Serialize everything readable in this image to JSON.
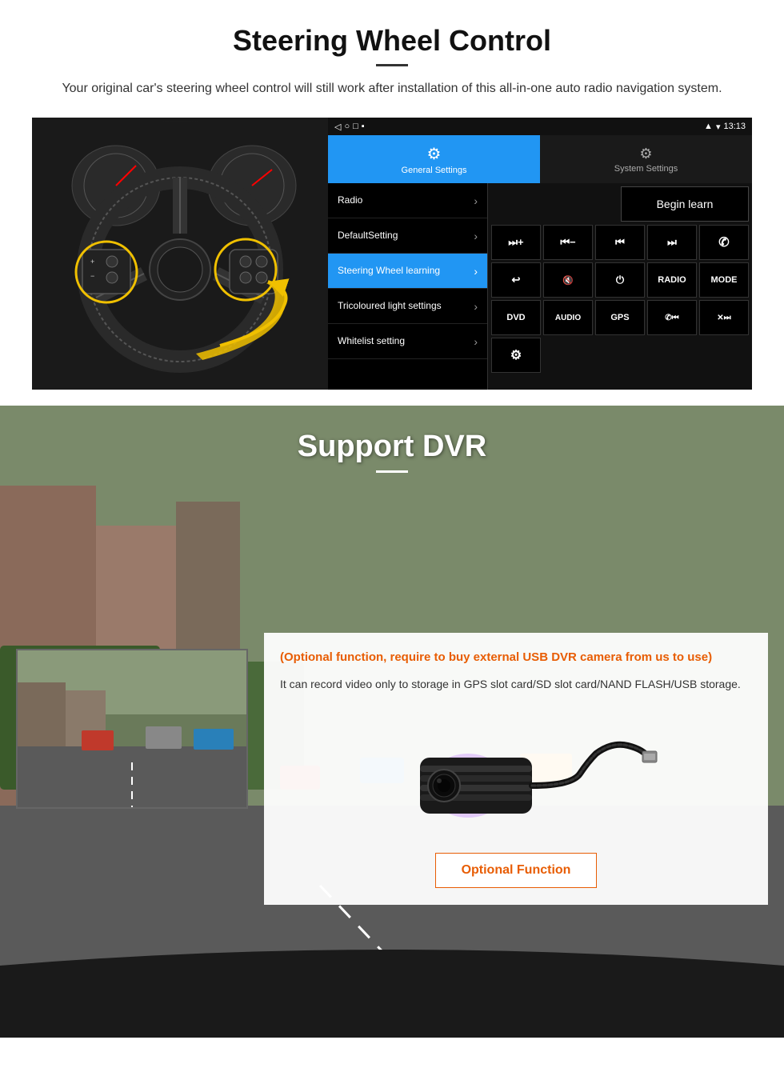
{
  "steering": {
    "title": "Steering Wheel Control",
    "description": "Your original car's steering wheel control will still work after installation of this all-in-one auto radio navigation system.",
    "statusbar": {
      "signal": "▾",
      "wifi": "▾",
      "time": "13:13"
    },
    "tabs": [
      {
        "label": "General Settings",
        "icon": "⚙",
        "active": true
      },
      {
        "label": "System Settings",
        "icon": "🔧",
        "active": false
      }
    ],
    "menu_items": [
      {
        "label": "Radio",
        "active": false
      },
      {
        "label": "DefaultSetting",
        "active": false
      },
      {
        "label": "Steering Wheel learning",
        "active": true
      },
      {
        "label": "Tricoloured light settings",
        "active": false
      },
      {
        "label": "Whitelist setting",
        "active": false
      }
    ],
    "begin_learn": "Begin learn",
    "buttons": [
      "⏭+",
      "⏮−",
      "⏮⏮",
      "⏭⏭",
      "☎",
      "↩",
      "🔇",
      "⏻",
      "RADIO",
      "MODE",
      "DVD",
      "AUDIO",
      "GPS",
      "☎⏮",
      "⏭⏭"
    ],
    "button_labels": [
      "⏭+",
      "⏮−",
      "⏮⏮",
      "⏭⏭",
      "✆",
      "↩",
      "✕",
      "⏻",
      "RADIO",
      "MODE",
      "DVD",
      "AUDIO",
      "GPS",
      "✆⏮",
      "✕⏭"
    ]
  },
  "dvr": {
    "title": "Support DVR",
    "optional_notice": "(Optional function, require to buy external USB DVR camera from us to use)",
    "description": "It can record video only to storage in GPS slot card/SD slot card/NAND FLASH/USB storage.",
    "optional_function_label": "Optional Function"
  }
}
